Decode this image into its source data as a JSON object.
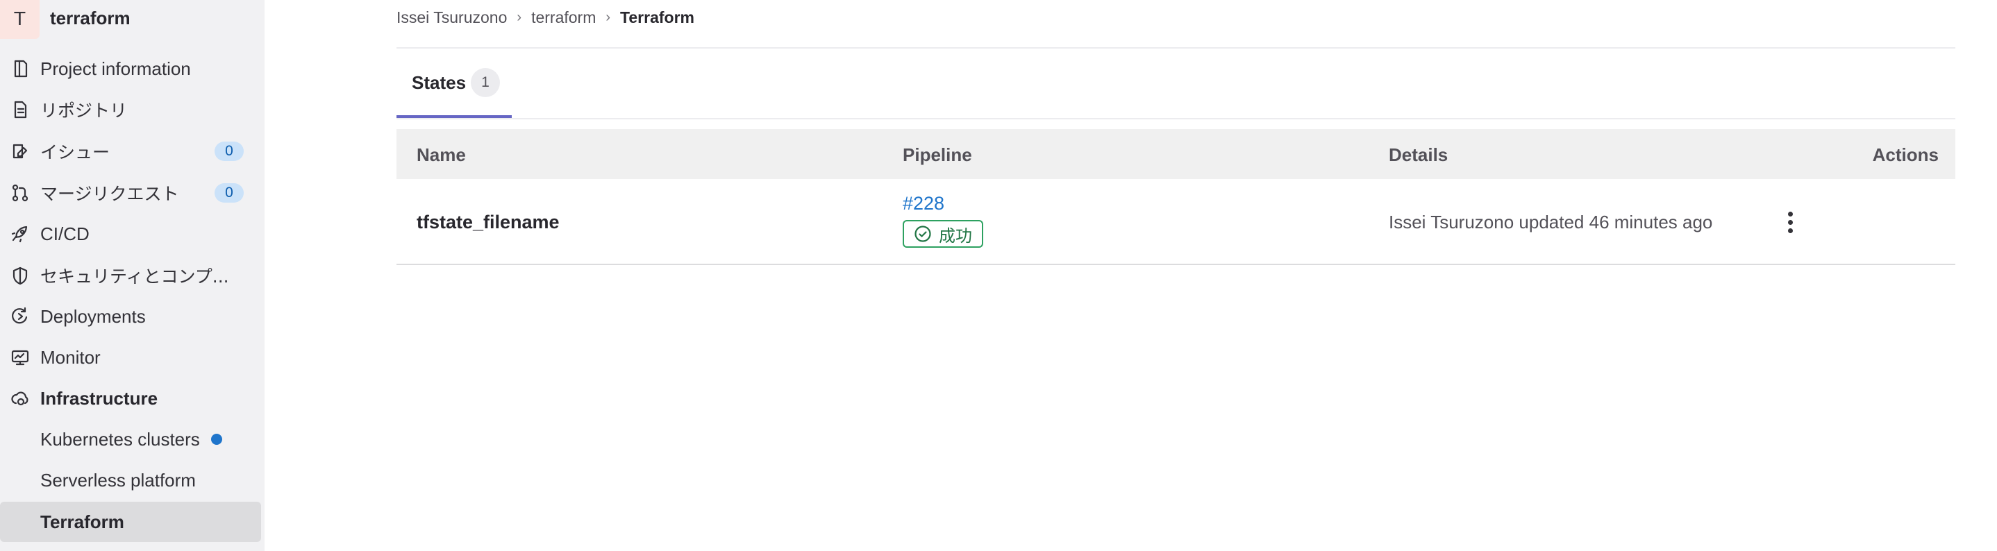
{
  "project": {
    "avatar_letter": "T",
    "name": "terraform"
  },
  "sidebar": {
    "items": [
      {
        "label": "Project information",
        "icon": "project-icon"
      },
      {
        "label": "リポジトリ",
        "icon": "document-icon"
      },
      {
        "label": "イシュー",
        "icon": "issues-icon",
        "count": "0"
      },
      {
        "label": "マージリクエスト",
        "icon": "merge-request-icon",
        "count": "0"
      },
      {
        "label": "CI/CD",
        "icon": "rocket-icon"
      },
      {
        "label": "セキュリティとコンプ...",
        "icon": "shield-icon"
      },
      {
        "label": "Deployments",
        "icon": "deployments-icon"
      },
      {
        "label": "Monitor",
        "icon": "monitor-icon"
      },
      {
        "label": "Infrastructure",
        "icon": "cloud-gear-icon"
      }
    ],
    "subitems": [
      {
        "label": "Kubernetes clusters"
      },
      {
        "label": "Serverless platform"
      },
      {
        "label": "Terraform"
      }
    ]
  },
  "breadcrumb": {
    "items": [
      "Issei Tsuruzono",
      "terraform"
    ],
    "current": "Terraform",
    "separator": "›"
  },
  "tabs": [
    {
      "label": "States",
      "count": "1"
    }
  ],
  "table": {
    "headers": {
      "name": "Name",
      "pipeline": "Pipeline",
      "details": "Details",
      "actions": "Actions"
    },
    "rows": [
      {
        "name": "tfstate_filename",
        "pipeline_id": "#228",
        "pipeline_status": "成功",
        "details": "Issei Tsuruzono updated 46 minutes ago"
      }
    ]
  },
  "colors": {
    "accent": "#6666c4",
    "link": "#1f75cb",
    "success": "#217645",
    "sidebar_bg": "#f1f1f3"
  }
}
